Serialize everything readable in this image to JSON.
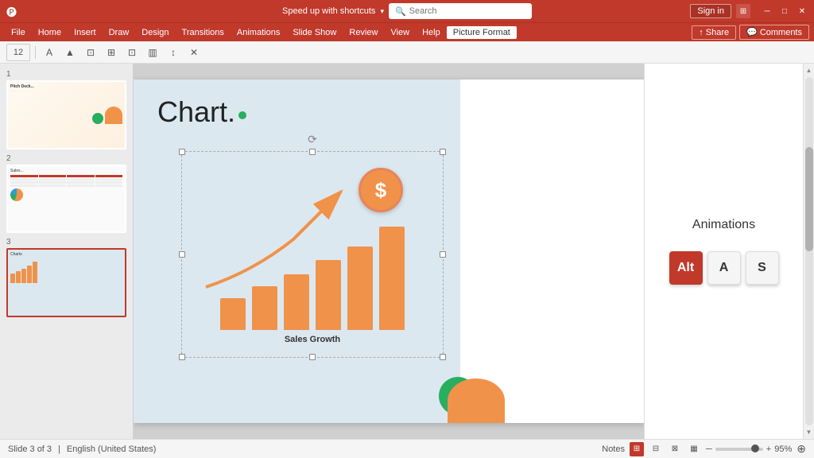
{
  "titlebar": {
    "title": "Speed up with shortcuts",
    "dropdown_icon": "▾",
    "search_placeholder": "Search",
    "signin_label": "Sign in",
    "ribbon_icon": "⊞",
    "minimize": "─",
    "maximize": "□",
    "close": "✕"
  },
  "menubar": {
    "items": [
      "File",
      "Home",
      "Insert",
      "Draw",
      "Design",
      "Transitions",
      "Animations",
      "Slide Show",
      "Review",
      "View",
      "Help",
      "Picture Format"
    ],
    "active_item": "Picture Format",
    "share_label": "Share",
    "comments_label": "Comments"
  },
  "toolbar": {
    "font_size": "12",
    "buttons": [
      "A",
      "▲",
      "⊡",
      "⊞",
      "⊡",
      "▥",
      "↕",
      "✕"
    ]
  },
  "slides": {
    "current": 3,
    "total": 3,
    "thumb1_title": "Pitch Deck...",
    "thumb2_title": "Sales...",
    "thumb3_title": "Charts"
  },
  "slide": {
    "title": "Chart.",
    "chart_label": "Sales Growth",
    "animations_title": "Animations",
    "bars": [
      40,
      55,
      65,
      80,
      100,
      130
    ],
    "key_alt": "Alt",
    "key_a": "A",
    "key_s": "S"
  },
  "statusbar": {
    "slide_info": "Slide 3 of 3",
    "language": "English (United States)",
    "notes_label": "Notes",
    "zoom": "95%",
    "zoom_value": 95
  }
}
